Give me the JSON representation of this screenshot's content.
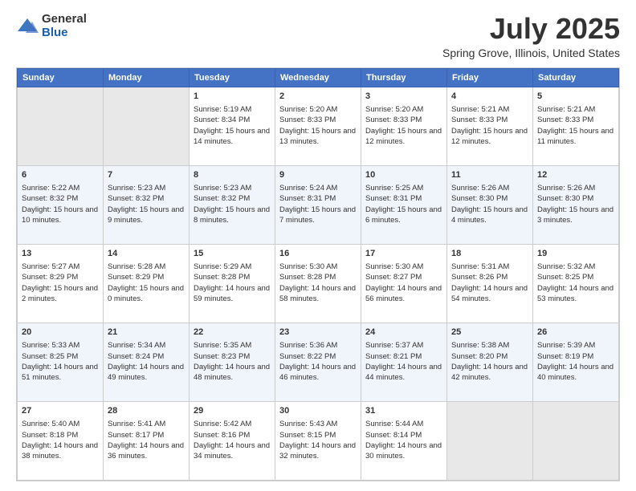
{
  "logo": {
    "general": "General",
    "blue": "Blue"
  },
  "title": "July 2025",
  "subtitle": "Spring Grove, Illinois, United States",
  "days_header": [
    "Sunday",
    "Monday",
    "Tuesday",
    "Wednesday",
    "Thursday",
    "Friday",
    "Saturday"
  ],
  "weeks": [
    [
      {
        "day": "",
        "content": ""
      },
      {
        "day": "",
        "content": ""
      },
      {
        "day": "1",
        "content": "Sunrise: 5:19 AM\nSunset: 8:34 PM\nDaylight: 15 hours and 14 minutes."
      },
      {
        "day": "2",
        "content": "Sunrise: 5:20 AM\nSunset: 8:33 PM\nDaylight: 15 hours and 13 minutes."
      },
      {
        "day": "3",
        "content": "Sunrise: 5:20 AM\nSunset: 8:33 PM\nDaylight: 15 hours and 12 minutes."
      },
      {
        "day": "4",
        "content": "Sunrise: 5:21 AM\nSunset: 8:33 PM\nDaylight: 15 hours and 12 minutes."
      },
      {
        "day": "5",
        "content": "Sunrise: 5:21 AM\nSunset: 8:33 PM\nDaylight: 15 hours and 11 minutes."
      }
    ],
    [
      {
        "day": "6",
        "content": "Sunrise: 5:22 AM\nSunset: 8:32 PM\nDaylight: 15 hours and 10 minutes."
      },
      {
        "day": "7",
        "content": "Sunrise: 5:23 AM\nSunset: 8:32 PM\nDaylight: 15 hours and 9 minutes."
      },
      {
        "day": "8",
        "content": "Sunrise: 5:23 AM\nSunset: 8:32 PM\nDaylight: 15 hours and 8 minutes."
      },
      {
        "day": "9",
        "content": "Sunrise: 5:24 AM\nSunset: 8:31 PM\nDaylight: 15 hours and 7 minutes."
      },
      {
        "day": "10",
        "content": "Sunrise: 5:25 AM\nSunset: 8:31 PM\nDaylight: 15 hours and 6 minutes."
      },
      {
        "day": "11",
        "content": "Sunrise: 5:26 AM\nSunset: 8:30 PM\nDaylight: 15 hours and 4 minutes."
      },
      {
        "day": "12",
        "content": "Sunrise: 5:26 AM\nSunset: 8:30 PM\nDaylight: 15 hours and 3 minutes."
      }
    ],
    [
      {
        "day": "13",
        "content": "Sunrise: 5:27 AM\nSunset: 8:29 PM\nDaylight: 15 hours and 2 minutes."
      },
      {
        "day": "14",
        "content": "Sunrise: 5:28 AM\nSunset: 8:29 PM\nDaylight: 15 hours and 0 minutes."
      },
      {
        "day": "15",
        "content": "Sunrise: 5:29 AM\nSunset: 8:28 PM\nDaylight: 14 hours and 59 minutes."
      },
      {
        "day": "16",
        "content": "Sunrise: 5:30 AM\nSunset: 8:28 PM\nDaylight: 14 hours and 58 minutes."
      },
      {
        "day": "17",
        "content": "Sunrise: 5:30 AM\nSunset: 8:27 PM\nDaylight: 14 hours and 56 minutes."
      },
      {
        "day": "18",
        "content": "Sunrise: 5:31 AM\nSunset: 8:26 PM\nDaylight: 14 hours and 54 minutes."
      },
      {
        "day": "19",
        "content": "Sunrise: 5:32 AM\nSunset: 8:25 PM\nDaylight: 14 hours and 53 minutes."
      }
    ],
    [
      {
        "day": "20",
        "content": "Sunrise: 5:33 AM\nSunset: 8:25 PM\nDaylight: 14 hours and 51 minutes."
      },
      {
        "day": "21",
        "content": "Sunrise: 5:34 AM\nSunset: 8:24 PM\nDaylight: 14 hours and 49 minutes."
      },
      {
        "day": "22",
        "content": "Sunrise: 5:35 AM\nSunset: 8:23 PM\nDaylight: 14 hours and 48 minutes."
      },
      {
        "day": "23",
        "content": "Sunrise: 5:36 AM\nSunset: 8:22 PM\nDaylight: 14 hours and 46 minutes."
      },
      {
        "day": "24",
        "content": "Sunrise: 5:37 AM\nSunset: 8:21 PM\nDaylight: 14 hours and 44 minutes."
      },
      {
        "day": "25",
        "content": "Sunrise: 5:38 AM\nSunset: 8:20 PM\nDaylight: 14 hours and 42 minutes."
      },
      {
        "day": "26",
        "content": "Sunrise: 5:39 AM\nSunset: 8:19 PM\nDaylight: 14 hours and 40 minutes."
      }
    ],
    [
      {
        "day": "27",
        "content": "Sunrise: 5:40 AM\nSunset: 8:18 PM\nDaylight: 14 hours and 38 minutes."
      },
      {
        "day": "28",
        "content": "Sunrise: 5:41 AM\nSunset: 8:17 PM\nDaylight: 14 hours and 36 minutes."
      },
      {
        "day": "29",
        "content": "Sunrise: 5:42 AM\nSunset: 8:16 PM\nDaylight: 14 hours and 34 minutes."
      },
      {
        "day": "30",
        "content": "Sunrise: 5:43 AM\nSunset: 8:15 PM\nDaylight: 14 hours and 32 minutes."
      },
      {
        "day": "31",
        "content": "Sunrise: 5:44 AM\nSunset: 8:14 PM\nDaylight: 14 hours and 30 minutes."
      },
      {
        "day": "",
        "content": ""
      },
      {
        "day": "",
        "content": ""
      }
    ]
  ]
}
